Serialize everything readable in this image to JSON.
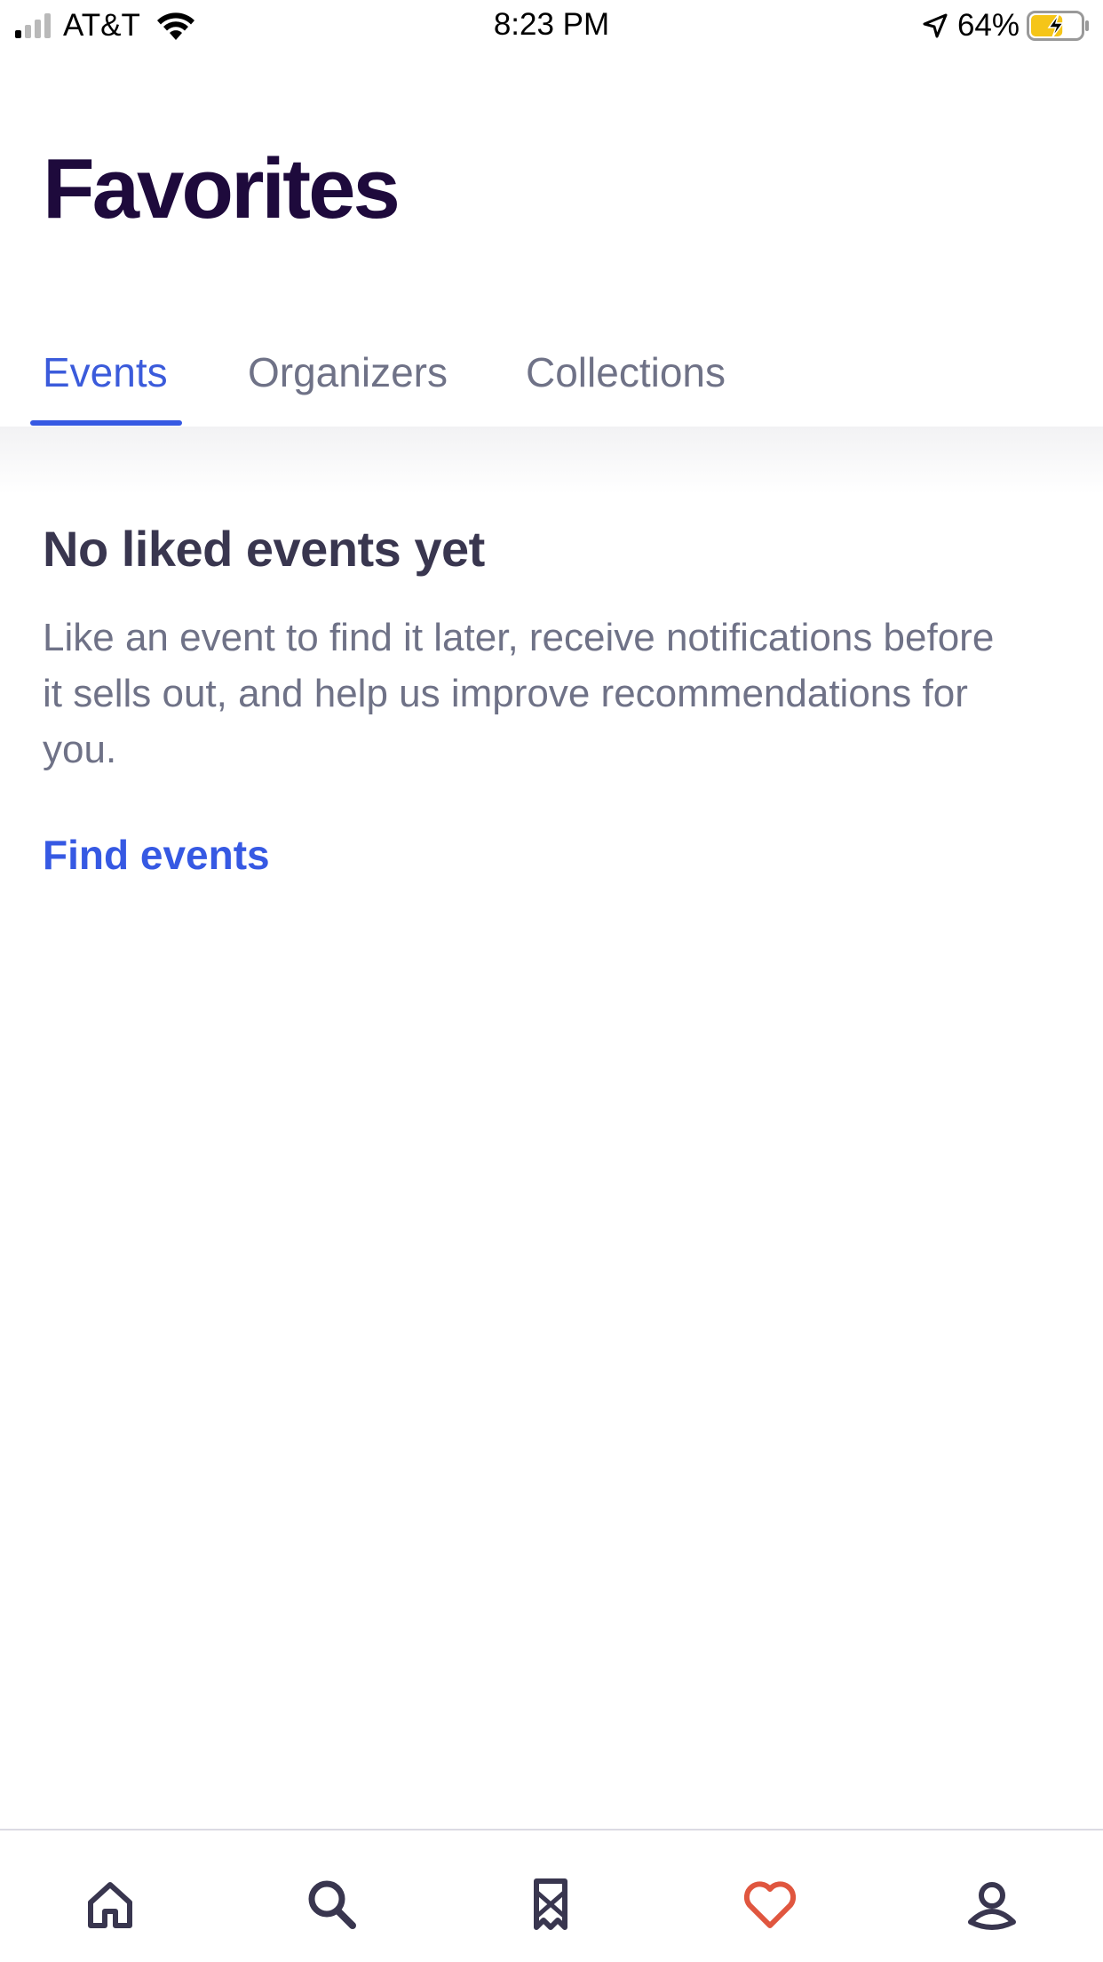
{
  "status_bar": {
    "carrier": "AT&T",
    "time": "8:23 PM",
    "battery_percent": "64%",
    "battery_level": 0.64,
    "signal_bars": 1,
    "charging": true
  },
  "page": {
    "title": "Favorites"
  },
  "tabs": [
    {
      "label": "Events",
      "active": true
    },
    {
      "label": "Organizers",
      "active": false
    },
    {
      "label": "Collections",
      "active": false
    }
  ],
  "empty_state": {
    "title": "No liked events yet",
    "description": "Like an event to find it later, receive notifications before it sells out, and help us improve recommendations for you.",
    "action_label": "Find events"
  },
  "bottom_nav": [
    {
      "icon": "home-icon",
      "active": false
    },
    {
      "icon": "search-icon",
      "active": false
    },
    {
      "icon": "ticket-icon",
      "active": false
    },
    {
      "icon": "heart-icon",
      "active": true
    },
    {
      "icon": "profile-icon",
      "active": false
    }
  ],
  "colors": {
    "title": "#1e0a3c",
    "accent": "#3659e3",
    "muted_text": "#6f7287",
    "heading_text": "#39364f",
    "active_nav": "#e0563f",
    "nav_icon": "#39364f",
    "battery_charge": "#f5c518"
  }
}
